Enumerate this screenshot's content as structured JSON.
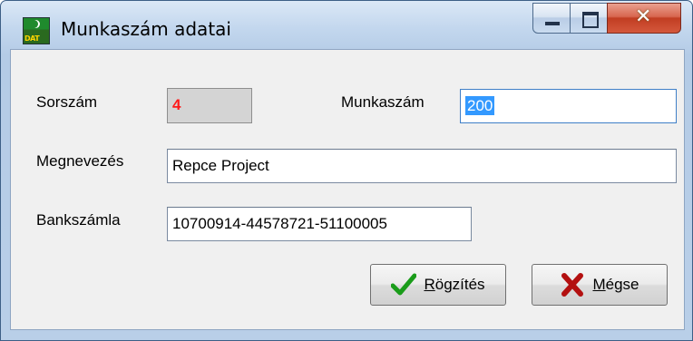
{
  "window": {
    "title": "Munkaszám adatai",
    "app_icon_text": "DAT"
  },
  "form": {
    "sorszam_label": "Sorszám",
    "sorszam_value": "4",
    "munkaszam_label": "Munkaszám",
    "munkaszam_value": "200",
    "megnevezes_label": "Megnevezés",
    "megnevezes_value": "Repce Project",
    "bankszamla_label": "Bankszámla",
    "bankszamla_value": "10700914-44578721-51100005"
  },
  "buttons": {
    "save_mnemonic": "R",
    "save_rest": "ögzítés",
    "cancel_mnemonic": "M",
    "cancel_rest": "égse"
  },
  "colors": {
    "check": "#1a9c1a",
    "cross": "#b31010",
    "id_value": "#ff1a1a",
    "selection": "#3399ff"
  }
}
